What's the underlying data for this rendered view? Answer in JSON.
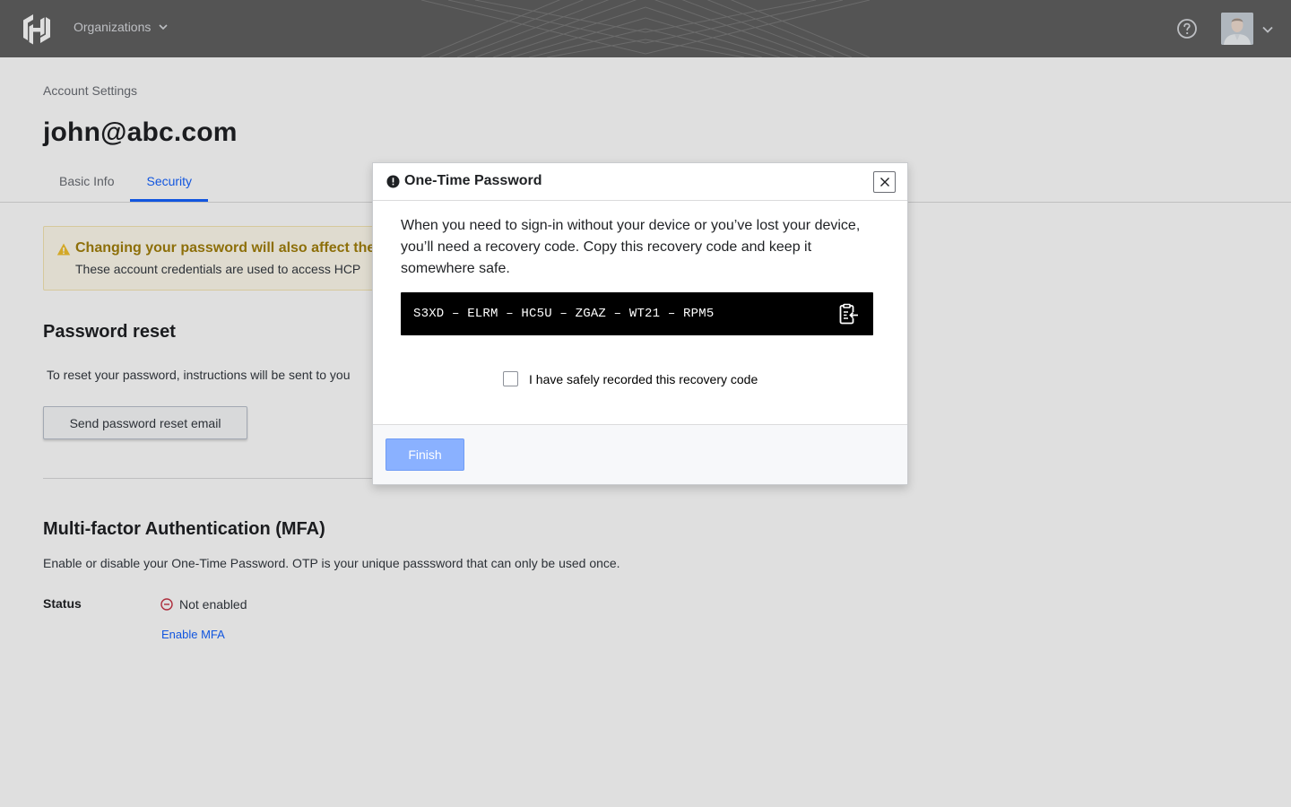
{
  "topbar": {
    "org_label": "Organizations"
  },
  "page": {
    "breadcrumb": "Account Settings",
    "title": "john@abc.com",
    "tabs": [
      {
        "label": "Basic Info",
        "active": false
      },
      {
        "label": "Security",
        "active": true
      }
    ]
  },
  "alert": {
    "title": "Changing your password will also affect the",
    "body": "These account credentials are used to access HCP"
  },
  "password_reset": {
    "title": "Password reset",
    "description": "To reset your password, instructions will be sent to you",
    "button_label": "Send password reset email"
  },
  "mfa": {
    "title": "Multi-factor Authentication (MFA)",
    "description": "Enable or disable your One-Time Password. OTP is your unique passsword that can only be used once.",
    "status_label": "Status",
    "status_value": "Not enabled",
    "enable_link": "Enable MFA"
  },
  "modal": {
    "title": "One-Time Password",
    "body": "When you need to sign-in without your device or you’ve lost your device, you’ll need a recovery code. Copy this recovery code and keep it somewhere safe.",
    "recovery_code": "S3XD – ELRM – HC5U – ZGAZ – WT21 – RPM5",
    "confirm_label": "I have safely recorded this recovery code",
    "confirm_checked": false,
    "finish_label": "Finish"
  },
  "colors": {
    "accent": "#1563ff",
    "finish_disabled": "#8ab1ff",
    "warning_text": "#a27f0b",
    "error": "#c73445"
  }
}
